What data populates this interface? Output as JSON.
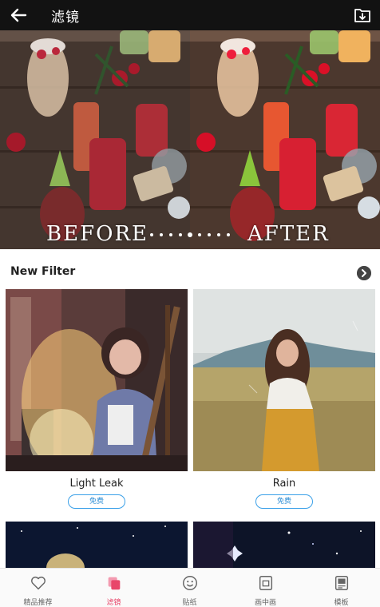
{
  "header": {
    "title": "滤镜",
    "back_icon": "arrow-left-icon",
    "save_icon": "download-box-icon"
  },
  "hero": {
    "before": "BEFORE",
    "after": "AFTER"
  },
  "section": {
    "title": "New Filter"
  },
  "filters": [
    {
      "name": "Light Leak",
      "badge": "免费"
    },
    {
      "name": "Rain",
      "badge": "免费"
    }
  ],
  "tabs": [
    {
      "label": "精品推荐",
      "icon": "heart-icon"
    },
    {
      "label": "滤镜",
      "icon": "filter-layers-icon",
      "active": true
    },
    {
      "label": "贴纸",
      "icon": "smile-icon"
    },
    {
      "label": "画中画",
      "icon": "picture-in-picture-icon"
    },
    {
      "label": "模板",
      "icon": "template-icon"
    }
  ],
  "colors": {
    "accent": "#e8466a",
    "badge_blue": "#3aa0e8",
    "topbar": "#121212"
  }
}
